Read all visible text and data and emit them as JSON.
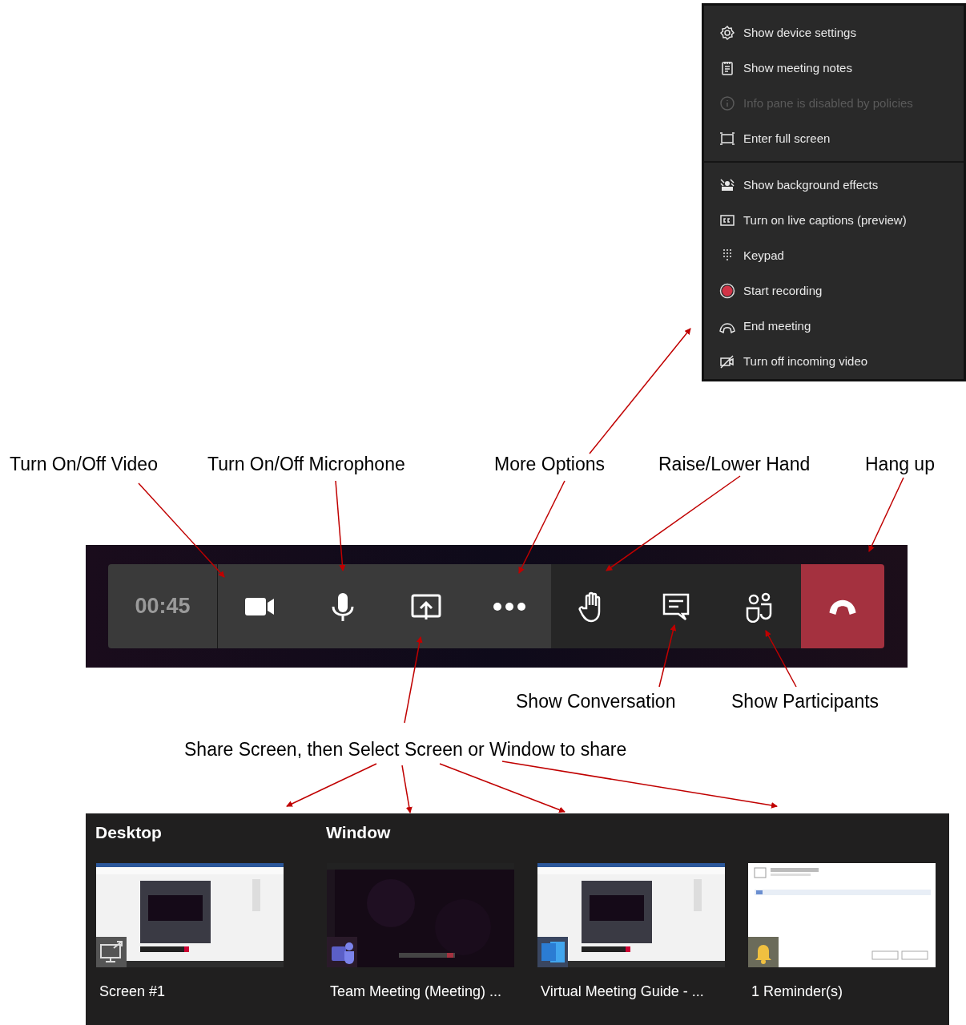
{
  "more_options_menu": {
    "items": [
      {
        "label": "Show device settings",
        "kind": "gear",
        "disabled": false,
        "divider_after": false
      },
      {
        "label": "Show meeting notes",
        "kind": "notes",
        "disabled": false,
        "divider_after": false
      },
      {
        "label": "Info pane is disabled by policies",
        "kind": "info",
        "disabled": true,
        "divider_after": false
      },
      {
        "label": "Enter full screen",
        "kind": "fullscreen",
        "disabled": false,
        "divider_after": true
      },
      {
        "label": "Show background effects",
        "kind": "background",
        "disabled": false,
        "divider_after": false
      },
      {
        "label": "Turn on live captions (preview)",
        "kind": "captions",
        "disabled": false,
        "divider_after": false
      },
      {
        "label": "Keypad",
        "kind": "keypad",
        "disabled": false,
        "divider_after": false
      },
      {
        "label": "Start recording",
        "kind": "record",
        "disabled": false,
        "divider_after": false
      },
      {
        "label": "End meeting",
        "kind": "phone",
        "disabled": false,
        "divider_after": false
      },
      {
        "label": "Turn off incoming video",
        "kind": "video_off",
        "disabled": false,
        "divider_after": false
      }
    ]
  },
  "top_labels": [
    "Turn On/Off Video",
    "Turn On/Off Microphone",
    "More Options",
    "Raise/Lower Hand",
    "Hang up"
  ],
  "meeting_toolbar": {
    "timer": "00:45",
    "buttons": [
      {
        "kind": "video"
      },
      {
        "kind": "mic"
      },
      {
        "kind": "share"
      },
      {
        "kind": "more"
      },
      {
        "kind": "hand"
      },
      {
        "kind": "chat"
      },
      {
        "kind": "people"
      },
      {
        "kind": "hangup"
      }
    ]
  },
  "bottom_labels": [
    "Show Conversation",
    "Show Participants"
  ],
  "share_caption": "Share Screen, then Select Screen or Window to share",
  "share_panel": {
    "sections": [
      {
        "title": "Desktop",
        "items": [
          {
            "caption": "Screen #1",
            "kind": "screen"
          }
        ]
      },
      {
        "title": "Window",
        "items": [
          {
            "caption": "Team Meeting (Meeting) ...",
            "kind": "teams"
          },
          {
            "caption": "Virtual Meeting Guide - ...",
            "kind": "word"
          },
          {
            "caption": "1 Reminder(s)",
            "kind": "reminder"
          }
        ]
      }
    ]
  }
}
